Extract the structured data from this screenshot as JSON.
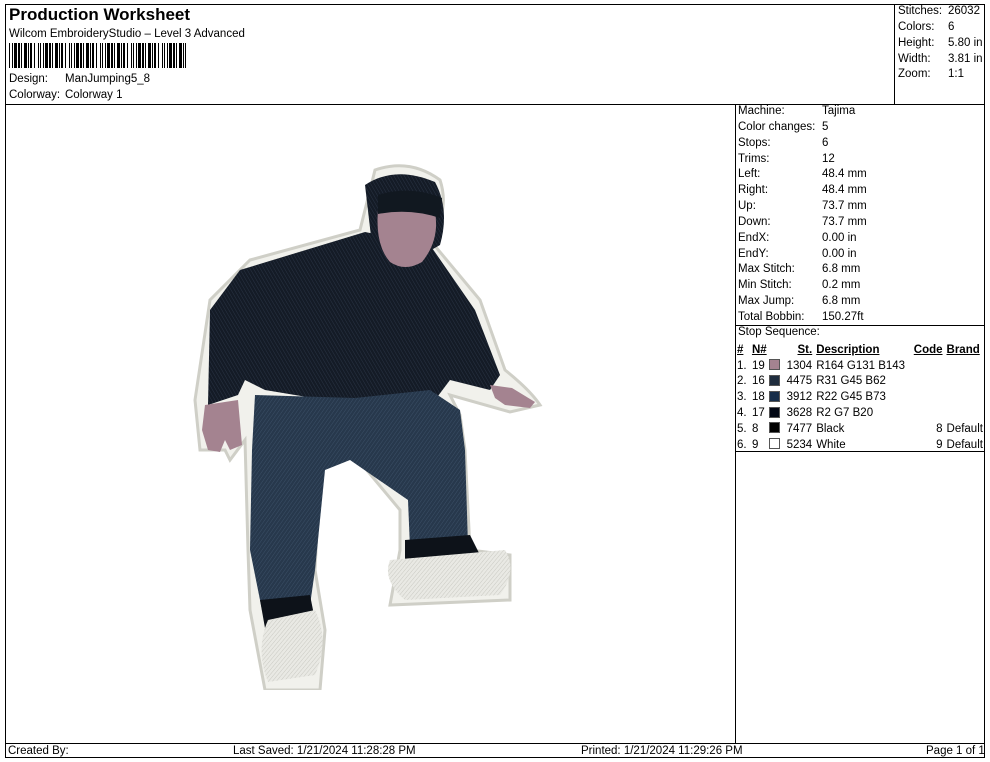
{
  "header": {
    "title": "Production Worksheet",
    "subtitle": "Wilcom EmbroideryStudio – Level 3 Advanced",
    "design_label": "Design:",
    "design_value": "ManJumping5_8",
    "colorway_label": "Colorway:",
    "colorway_value": "Colorway 1"
  },
  "summary": [
    {
      "label": "Stitches:",
      "value": "26032"
    },
    {
      "label": "Colors:",
      "value": "6"
    },
    {
      "label": "Height:",
      "value": "5.80 in"
    },
    {
      "label": "Width:",
      "value": "3.81 in"
    },
    {
      "label": "Zoom:",
      "value": "1:1"
    }
  ],
  "machine_info": [
    {
      "label": "Machine:",
      "value": "Tajima"
    },
    {
      "label": "Color changes:",
      "value": "5"
    },
    {
      "label": "Stops:",
      "value": "6"
    },
    {
      "label": "Trims:",
      "value": "12"
    },
    {
      "label": "Left:",
      "value": "48.4 mm"
    },
    {
      "label": "Right:",
      "value": "48.4 mm"
    },
    {
      "label": "Up:",
      "value": "73.7 mm"
    },
    {
      "label": "Down:",
      "value": "73.7 mm"
    },
    {
      "label": "EndX:",
      "value": "0.00 in"
    },
    {
      "label": "EndY:",
      "value": "0.00 in"
    },
    {
      "label": "Max Stitch:",
      "value": "6.8 mm"
    },
    {
      "label": "Min Stitch:",
      "value": "0.2 mm"
    },
    {
      "label": "Max Jump:",
      "value": "6.8 mm"
    },
    {
      "label": "Total Bobbin:",
      "value": "150.27ft"
    }
  ],
  "stop_sequence": {
    "title": "Stop Sequence:",
    "headers": {
      "num": "#",
      "n": "N#",
      "st": "St.",
      "description": "Description",
      "code": "Code",
      "brand": "Brand"
    },
    "rows": [
      {
        "num": "1.",
        "n": "19",
        "color": "#A48390",
        "st": "1304",
        "description": "R164 G131 B143",
        "code": "",
        "brand": ""
      },
      {
        "num": "2.",
        "n": "16",
        "color": "#1F2D3E",
        "st": "4475",
        "description": "R31 G45 B62",
        "code": "",
        "brand": ""
      },
      {
        "num": "3.",
        "n": "18",
        "color": "#162D49",
        "st": "3912",
        "description": "R22 G45 B73",
        "code": "",
        "brand": ""
      },
      {
        "num": "4.",
        "n": "17",
        "color": "#020714",
        "st": "3628",
        "description": "R2 G7 B20",
        "code": "",
        "brand": ""
      },
      {
        "num": "5.",
        "n": "8",
        "color": "#000000",
        "st": "7477",
        "description": "Black",
        "code": "8",
        "brand": "Default"
      },
      {
        "num": "6.",
        "n": "9",
        "color": "#FFFFFF",
        "st": "5234",
        "description": "White",
        "code": "9",
        "brand": "Default"
      }
    ]
  },
  "footer": {
    "created_by": "Created By:",
    "last_saved": "Last Saved: 1/21/2024 11:28:28 PM",
    "printed": "Printed: 1/21/2024 11:29:26 PM",
    "page": "Page 1 of 1"
  }
}
